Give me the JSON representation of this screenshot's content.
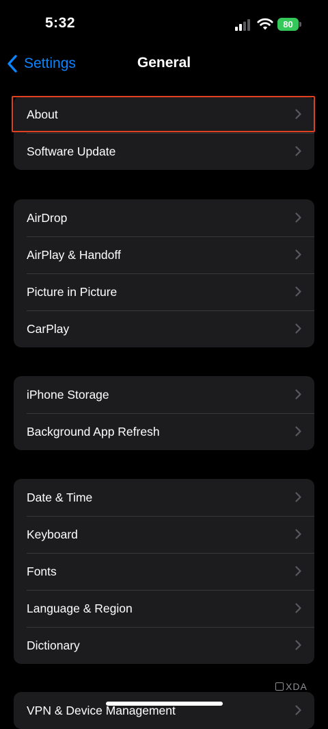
{
  "status_bar": {
    "time": "5:32",
    "battery": "80"
  },
  "nav": {
    "back_label": "Settings",
    "title": "General"
  },
  "groups": [
    {
      "items": [
        "About",
        "Software Update"
      ]
    },
    {
      "items": [
        "AirDrop",
        "AirPlay & Handoff",
        "Picture in Picture",
        "CarPlay"
      ]
    },
    {
      "items": [
        "iPhone Storage",
        "Background App Refresh"
      ]
    },
    {
      "items": [
        "Date & Time",
        "Keyboard",
        "Fonts",
        "Language & Region",
        "Dictionary"
      ]
    },
    {
      "items": [
        "VPN & Device Management"
      ]
    }
  ],
  "watermark": "XDA",
  "colors": {
    "background": "#000000",
    "cell": "#1c1c1e",
    "separator": "#38383a",
    "accent": "#0a84ff",
    "battery": "#34c759",
    "highlight": "#e0401f",
    "chevron": "#5a5a5e"
  }
}
